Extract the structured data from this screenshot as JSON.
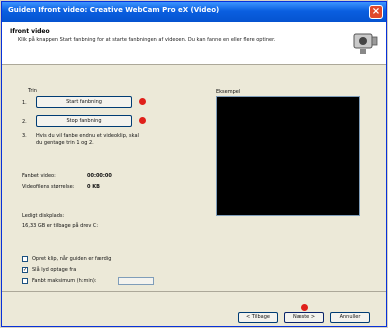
{
  "window": {
    "title": "Guiden Ifront video: Creative WebCam Pro eX (Video)"
  },
  "header": {
    "title": "Ifront video",
    "description": "Klik på knappen Start fanbning for at starte fanbningen af videoen. Du kan fanne en eller flere optiner."
  },
  "left": {
    "steps_title": "Trin",
    "step1_num": "1.",
    "start_button": "Start fanbning",
    "step2_num": "2.",
    "stop_button": "Stop fanbning",
    "step3_num": "3.",
    "step3_text": "Hvis du vil fanbe endnu et videoklip, skal du gentage trin 1 og 2.",
    "video_length_label": "Fanbet video:",
    "video_length_value": "00:00:00",
    "frames_label": "Videofilens størrelse:",
    "frames_value": "0 KB",
    "disk_label": "Ledigt diskplads:",
    "disk_value": "16,33 GB er tilbage på drev C:",
    "option1": "Opret klip, når guiden er færdig",
    "option2": "Slå lyd optage fra",
    "option3": "Fanbt maksimum (h:min):",
    "option2_checked": true
  },
  "preview": {
    "label": "Eksempel"
  },
  "footer": {
    "back": "< Tilbage",
    "next": "Næste >",
    "cancel": "Annuller"
  }
}
